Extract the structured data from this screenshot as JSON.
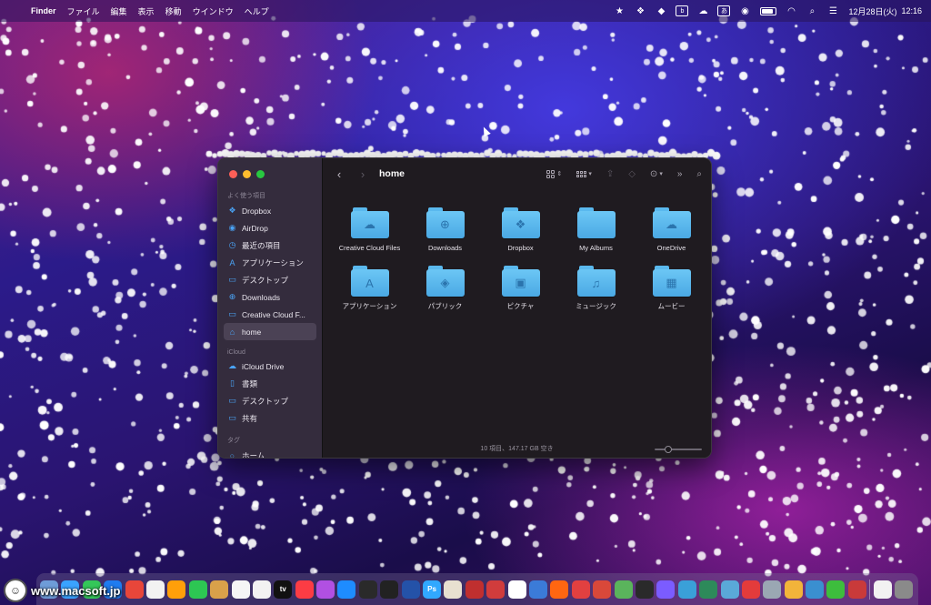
{
  "menubar": {
    "app": "Finder",
    "items": [
      "ファイル",
      "編集",
      "表示",
      "移動",
      "ウインドウ",
      "ヘルプ"
    ],
    "date": "12月28日(火)",
    "time": "12:16"
  },
  "finder": {
    "title": "home",
    "sidebar": {
      "favorites_header": "よく使う項目",
      "favorites": [
        {
          "label": "Dropbox",
          "icon": "dropbox-icon",
          "glyph": "❖"
        },
        {
          "label": "AirDrop",
          "icon": "airdrop-icon",
          "glyph": "◉"
        },
        {
          "label": "最近の項目",
          "icon": "clock-icon",
          "glyph": "◷"
        },
        {
          "label": "アプリケーション",
          "icon": "applications-icon",
          "glyph": "A"
        },
        {
          "label": "デスクトップ",
          "icon": "desktop-icon",
          "glyph": "▭"
        },
        {
          "label": "Downloads",
          "icon": "download-icon",
          "glyph": "⊕"
        },
        {
          "label": "Creative Cloud F...",
          "icon": "folder-icon",
          "glyph": "▭"
        },
        {
          "label": "home",
          "icon": "home-icon",
          "glyph": "⌂"
        }
      ],
      "icloud_header": "iCloud",
      "icloud": [
        {
          "label": "iCloud Drive",
          "icon": "cloud-icon",
          "glyph": "☁"
        },
        {
          "label": "書類",
          "icon": "document-icon",
          "glyph": "▯"
        },
        {
          "label": "デスクトップ",
          "icon": "desktop-icon",
          "glyph": "▭"
        },
        {
          "label": "共有",
          "icon": "shared-folder-icon",
          "glyph": "▭"
        }
      ],
      "tags_header": "タグ",
      "tags": [
        {
          "label": "ホーム",
          "icon": "tag-icon",
          "glyph": "○"
        }
      ]
    },
    "files": [
      {
        "label": "Creative Cloud Files",
        "glyph": "☁"
      },
      {
        "label": "Downloads",
        "glyph": "⊕"
      },
      {
        "label": "Dropbox",
        "glyph": "❖"
      },
      {
        "label": "My Albums",
        "glyph": ""
      },
      {
        "label": "OneDrive",
        "glyph": "☁"
      },
      {
        "label": "アプリケーション",
        "glyph": "A"
      },
      {
        "label": "パブリック",
        "glyph": "◈"
      },
      {
        "label": "ピクチャ",
        "glyph": "▣"
      },
      {
        "label": "ミュージック",
        "glyph": "♫"
      },
      {
        "label": "ムービー",
        "glyph": "▦"
      }
    ],
    "status": "10 項目、147.17 GB 空き",
    "zoom_level": 0.25
  },
  "dock": {
    "colors": [
      "#6e9cd8",
      "#3aa3ff",
      "#34c759",
      "#1f7cf0",
      "#e8463a",
      "#f2f2f2",
      "#ff9f0a",
      "#2dc653",
      "#d9a14a",
      "#f5f5f5",
      "#f2f2f2",
      "#111111",
      "#fc3c44",
      "#b150e2",
      "#1e8cff",
      "#2a2a2a",
      "#222222",
      "#2452a8",
      "#31a8ff",
      "#e8e0d0",
      "#c02f2f",
      "#d13c3c",
      "#ffffff",
      "#3b7bd8",
      "#ff6611",
      "#e24040",
      "#d9483a",
      "#5ab45c",
      "#2a2a2a",
      "#7b5cff",
      "#3aa0d8",
      "#2d8a5a",
      "#5aa9d8",
      "#e33b3b",
      "#9aa7b3",
      "#f2b43a",
      "#3a8fd0",
      "#3dbd3d",
      "#c93a3a",
      "#f2f2f2",
      "#8a8a8a"
    ],
    "glyphs": [
      "",
      "",
      "",
      "",
      "",
      "",
      "",
      "",
      "",
      "",
      "",
      "tv",
      "",
      "",
      "",
      "",
      "",
      "",
      "Ps",
      "",
      "",
      "",
      "",
      "",
      "",
      "",
      "",
      "",
      "",
      "",
      "",
      "",
      "",
      "",
      "",
      "",
      "",
      "",
      "",
      "",
      ""
    ]
  },
  "watermark": "www.macsoft.jp"
}
